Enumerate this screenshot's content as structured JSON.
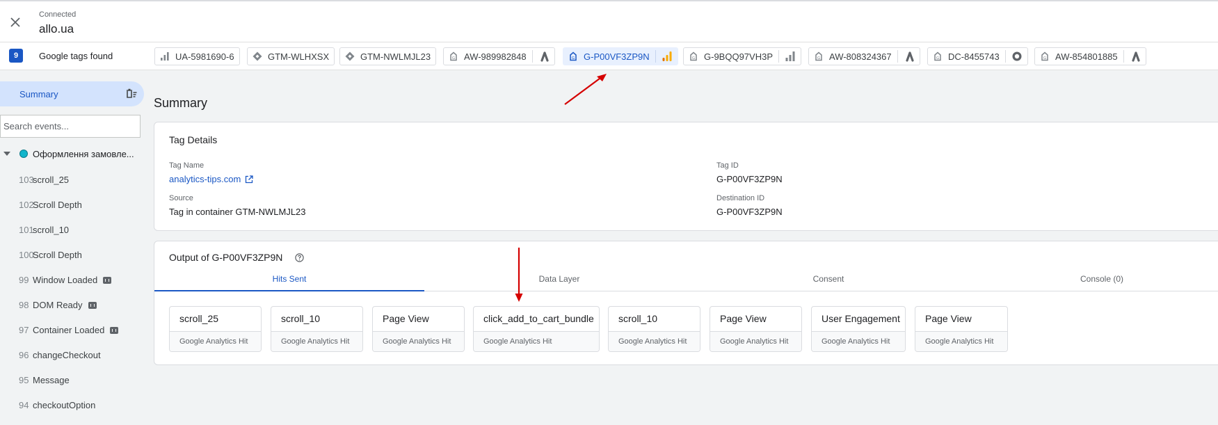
{
  "header": {
    "connection_status": "Connected",
    "site": "allo.ua"
  },
  "tags_bar": {
    "count": "9",
    "label": "Google tags found",
    "tags": [
      {
        "id": "UA-5981690-6",
        "icon": "analytics-bars-icon",
        "active": false
      },
      {
        "id": "GTM-WLHXSX",
        "icon": "gtm-diamond-icon",
        "active": false
      },
      {
        "id": "GTM-NWLMJL23",
        "icon": "gtm-diamond-icon",
        "active": false
      },
      {
        "id": "AW-989982848",
        "icon": "google-tag-icon",
        "secondary_icon": "google-ads-icon",
        "active": false
      },
      {
        "id": "G-P00VF3ZP9N",
        "icon": "google-tag-icon",
        "secondary_icon": "google-analytics-icon",
        "active": true
      },
      {
        "id": "G-9BQQ97VH3P",
        "icon": "google-tag-icon",
        "secondary_icon": "analytics-bars-icon",
        "active": false
      },
      {
        "id": "AW-808324367",
        "icon": "google-tag-icon",
        "secondary_icon": "google-ads-icon",
        "active": false
      },
      {
        "id": "DC-8455743",
        "icon": "google-tag-icon",
        "secondary_icon": "floodlight-icon",
        "active": false
      },
      {
        "id": "AW-854801885",
        "icon": "google-tag-icon",
        "secondary_icon": "google-ads-icon",
        "active": false
      }
    ]
  },
  "sidebar": {
    "summary_label": "Summary",
    "search_placeholder": "Search events...",
    "group_label": "Оформлення замовле...",
    "events": [
      {
        "num": "103",
        "name": "scroll_25",
        "badge": false
      },
      {
        "num": "102",
        "name": "Scroll Depth",
        "badge": false
      },
      {
        "num": "101",
        "name": "scroll_10",
        "badge": false
      },
      {
        "num": "100",
        "name": "Scroll Depth",
        "badge": false
      },
      {
        "num": "99",
        "name": "Window Loaded",
        "badge": true
      },
      {
        "num": "98",
        "name": "DOM Ready",
        "badge": true
      },
      {
        "num": "97",
        "name": "Container Loaded",
        "badge": true
      },
      {
        "num": "96",
        "name": "changeCheckout",
        "badge": false
      },
      {
        "num": "95",
        "name": "Message",
        "badge": false
      },
      {
        "num": "94",
        "name": "checkoutOption",
        "badge": false
      }
    ]
  },
  "main": {
    "title": "Summary",
    "tag_details": {
      "title": "Tag Details",
      "tag_name_label": "Tag Name",
      "tag_name_value": "analytics-tips.com",
      "source_label": "Source",
      "source_value": "Tag in container GTM-NWLMJL23",
      "tag_id_label": "Tag ID",
      "tag_id_value": "G-P00VF3ZP9N",
      "destination_id_label": "Destination ID",
      "destination_id_value": "G-P00VF3ZP9N"
    },
    "output": {
      "title": "Output of G-P00VF3ZP9N",
      "tabs": [
        {
          "label": "Hits Sent",
          "active": true
        },
        {
          "label": "Data Layer",
          "active": false
        },
        {
          "label": "Consent",
          "active": false
        },
        {
          "label": "Console (0)",
          "active": false
        }
      ],
      "hits": [
        {
          "name": "scroll_25",
          "type": "Google Analytics Hit"
        },
        {
          "name": "scroll_10",
          "type": "Google Analytics Hit"
        },
        {
          "name": "Page View",
          "type": "Google Analytics Hit"
        },
        {
          "name": "click_add_to_cart_bundle",
          "type": "Google Analytics Hit"
        },
        {
          "name": "scroll_10",
          "type": "Google Analytics Hit"
        },
        {
          "name": "Page View",
          "type": "Google Analytics Hit"
        },
        {
          "name": "User Engagement",
          "type": "Google Analytics Hit"
        },
        {
          "name": "Page View",
          "type": "Google Analytics Hit"
        }
      ]
    }
  },
  "colors": {
    "accent": "#1a57c4",
    "active_bg": "#d3e3fd",
    "annotation_arrow": "#d50000"
  }
}
